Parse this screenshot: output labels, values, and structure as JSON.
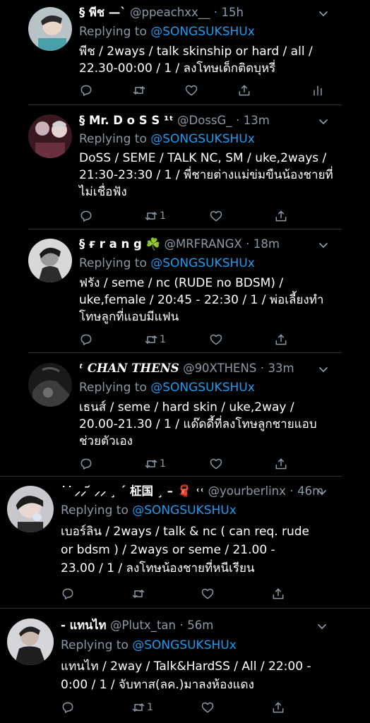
{
  "tweets": [
    {
      "name": "§ พีช —`",
      "handle": "@ppeachxx__",
      "time": "15h",
      "reply_prefix": "Replying to",
      "reply_to": "@SONGSUKSHUx",
      "lines": [
        "พีช / 2ways / talk skinship or hard / all /",
        "22.30-00:00 / 1 / ลงโทษเด็กติดบุหรี่"
      ],
      "retweet_count": "",
      "show_analytics": true
    },
    {
      "name": "§ Mr. D o S S ¹ᵗ",
      "handle": "@DossG_",
      "time": "13m",
      "reply_prefix": "Replying to",
      "reply_to": "@SONGSUKSHUx",
      "lines": [
        "DoSS / SEME / TALK NC, SM / uke,2ways /",
        "21:30-23:30 / 1 / พี่ชายต่างแม่ข่มขืนน้องชายที่",
        "ไม่เชื่อฟัง"
      ],
      "retweet_count": "1",
      "show_analytics": false
    },
    {
      "name": "§ ғ r a n g ☘️",
      "handle": "@MRFRANGX",
      "time": "18m",
      "reply_prefix": "Replying to",
      "reply_to": "@SONGSUKSHUx",
      "lines": [
        "ฟรัง / seme / nc (RUDE no BDSM) /",
        "uke,female / 20:45 - 22:30 / 1 / พ่อเลี้ยงทำ",
        "โทษลูกที่แอบมีแฟน"
      ],
      "retweet_count": "1",
      "show_analytics": false
    },
    {
      "name": "ᵗ CHAN THENS",
      "handle": "@90XTHENS",
      "time": "33m",
      "reply_prefix": "Replying to",
      "reply_to": "@SONGSUKSHUx",
      "lines": [
        "เธนส์ / seme / hard skin / uke,2way /",
        "20.00-21.30 / 1 / แด๊ดดี้ที่ลงโทษลูกชายแอบ",
        "ช่วยตัวเอง"
      ],
      "retweet_count": "1",
      "show_analytics": false
    },
    {
      "name": "˙ ͘ ⸝⸝ ᷄ ⸝⸝ ¸ ˊ 柾国 ¸ – 🧣 ˓˓",
      "handle": "@yourberlinx",
      "time": "46m",
      "reply_prefix": "Replying to",
      "reply_to": "@SONGSUKSHUx",
      "lines": [
        "เบอร์ลิน / 2ways / talk & nc ( can req. rude",
        "or bdsm ) / 2ways or seme / 21.00 -",
        "23.00 / 1 / ลงโทษน้องชายที่หนีเรียน"
      ],
      "retweet_count": "",
      "show_analytics": false
    },
    {
      "name": "- แทนไท",
      "handle": "@Plutx_tan",
      "time": "56m",
      "reply_prefix": "Replying to",
      "reply_to": "@SONGSUKSHUx",
      "lines": [
        "แทนไท / 2way / Talk&HardSS / All / 22:00 -",
        "0:00 / 1 / จับทาส(ลค.)มาลงห้องแดง"
      ],
      "retweet_count": "1",
      "show_analytics": false
    }
  ],
  "icons": {
    "reply": "reply-icon",
    "retweet": "retweet-icon",
    "like": "heart-icon",
    "share": "share-icon",
    "analytics": "analytics-icon",
    "more": "chevron-down-icon"
  },
  "colors": {
    "background": "#000000",
    "mention": "#1d9bf0",
    "secondary_text": "#8b98a5"
  }
}
